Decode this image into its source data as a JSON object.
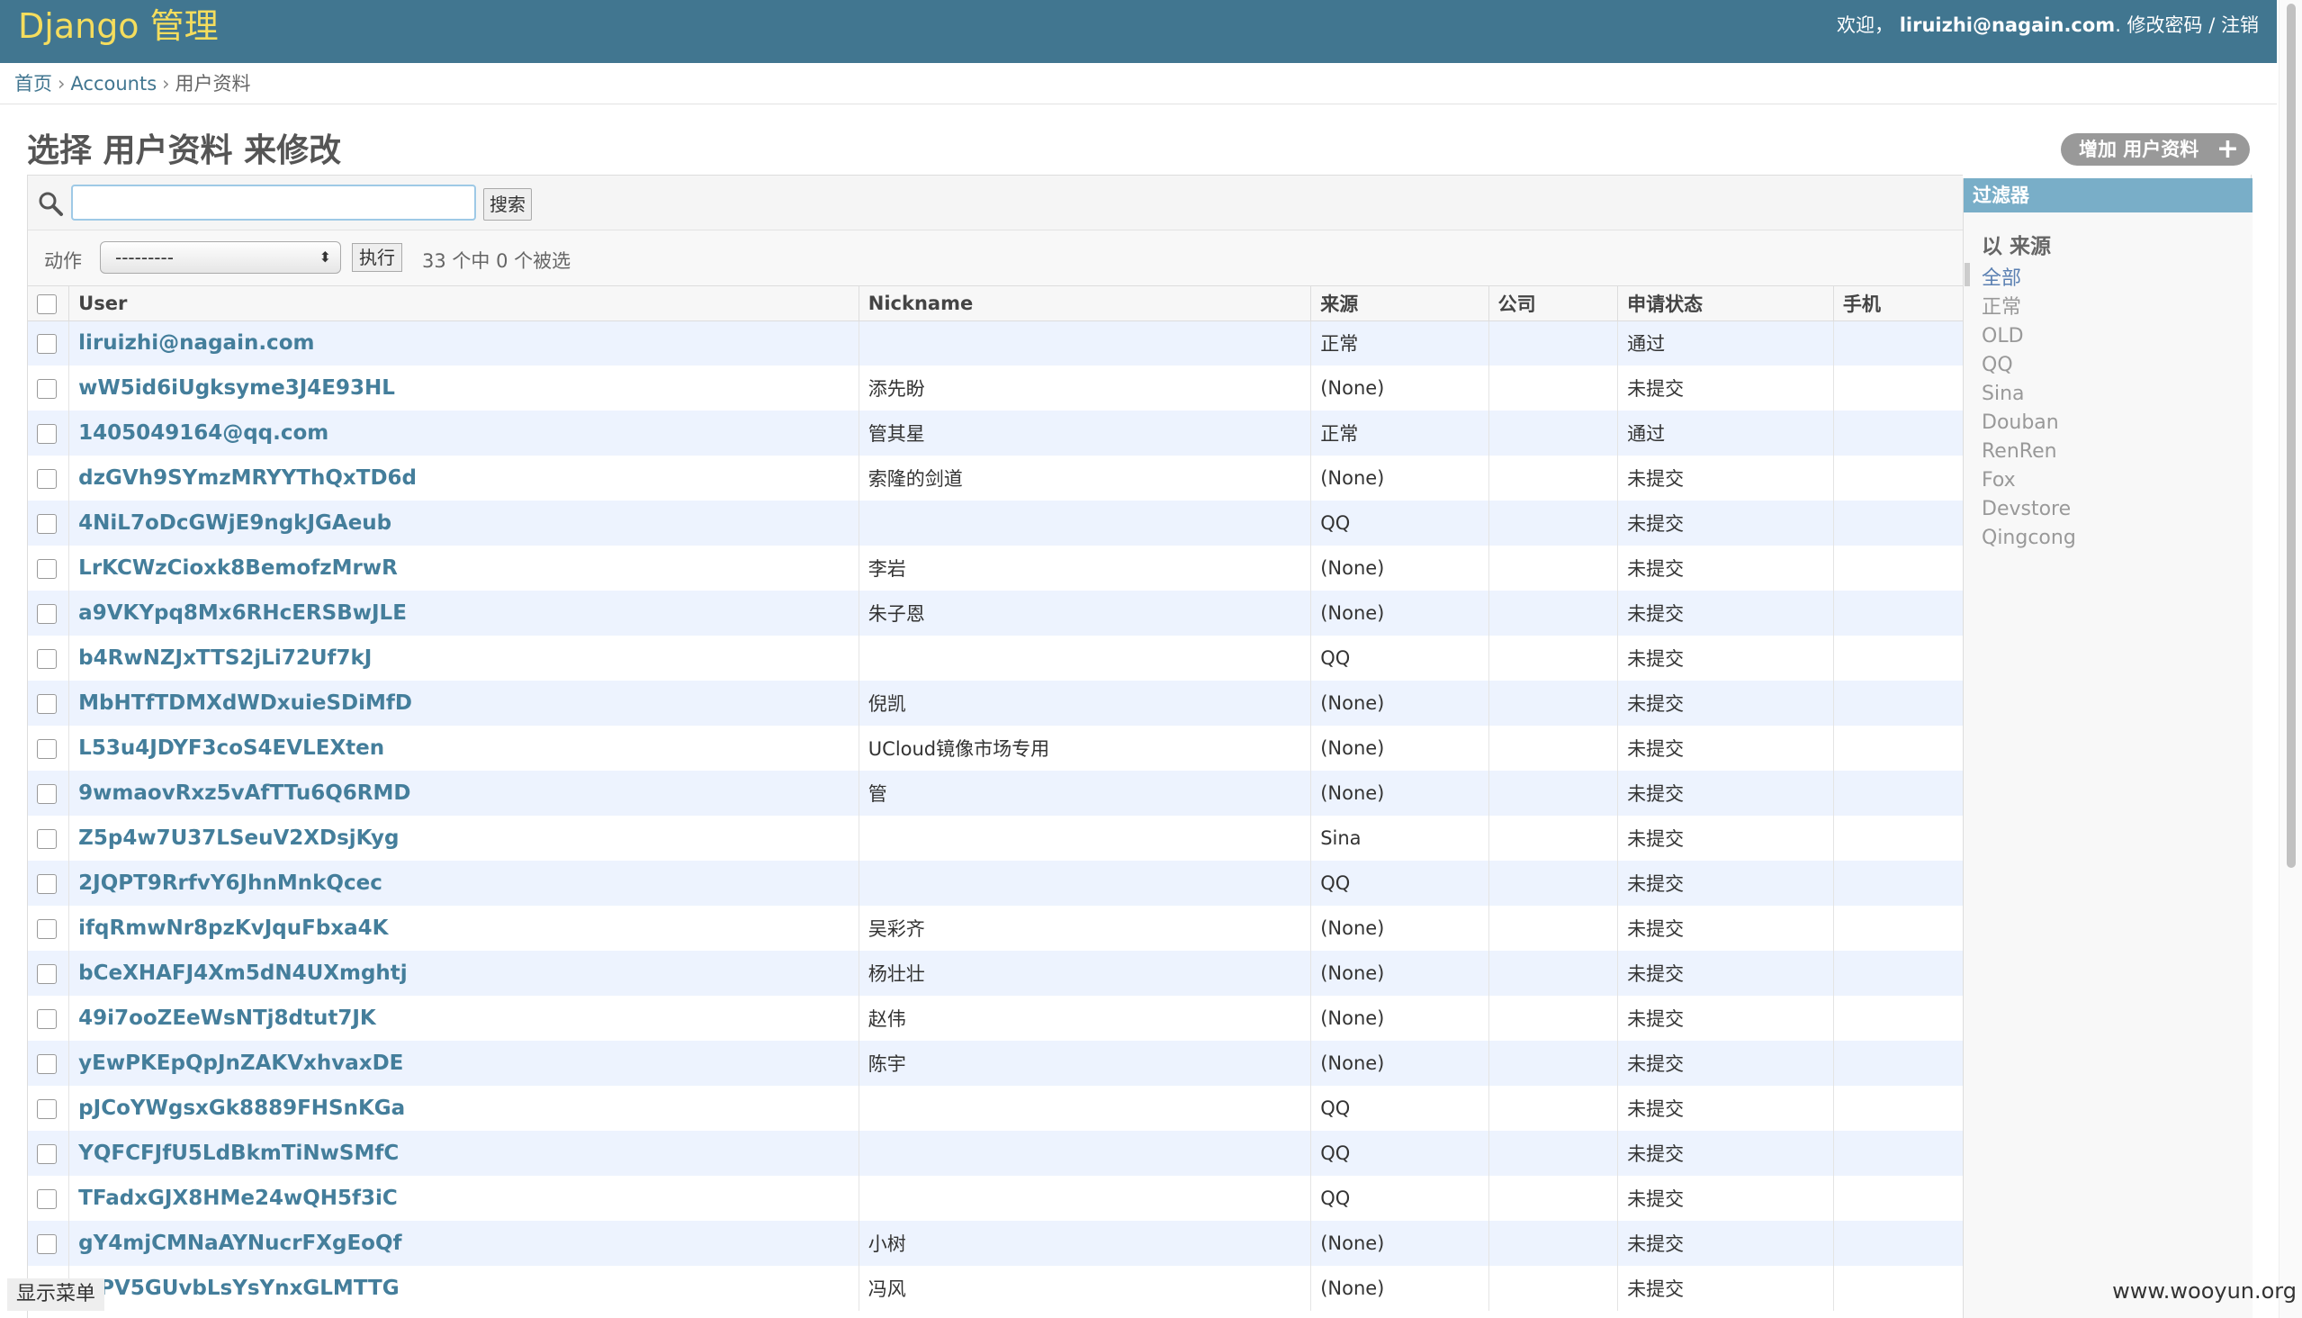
{
  "header": {
    "brand": "Django 管理",
    "welcome": "欢迎，",
    "user": "liruizhi@nagain.com",
    "change_password": "修改密码",
    "separator": "/",
    "logout": "注销"
  },
  "breadcrumbs": {
    "home": "首页",
    "app": "Accounts",
    "current": "用户资料",
    "sep": "›"
  },
  "page_title": "选择 用户资料 来修改",
  "add_button": {
    "label": "增加 用户资料",
    "plus": "+"
  },
  "search": {
    "value": "",
    "button": "搜索"
  },
  "actions": {
    "label": "动作",
    "selected": "---------",
    "go_button": "执行",
    "counter": "33 个中 0 个被选"
  },
  "table": {
    "columns": [
      "User",
      "Nickname",
      "来源",
      "公司",
      "申请状态",
      "手机"
    ],
    "rows": [
      {
        "user": "liruizhi@nagain.com",
        "nickname": "",
        "source": "正常",
        "company": "",
        "status": "通过",
        "phone": ""
      },
      {
        "user": "wW5id6iUgksyme3J4E93HL",
        "nickname": "添先盼",
        "source": "(None)",
        "company": "",
        "status": "未提交",
        "phone": ""
      },
      {
        "user": "1405049164@qq.com",
        "nickname": "管其星",
        "source": "正常",
        "company": "",
        "status": "通过",
        "phone": ""
      },
      {
        "user": "dzGVh9SYmzMRYYThQxTD6d",
        "nickname": "索隆的剑道",
        "source": "(None)",
        "company": "",
        "status": "未提交",
        "phone": ""
      },
      {
        "user": "4NiL7oDcGWjE9ngkJGAeub",
        "nickname": "",
        "source": "QQ",
        "company": "",
        "status": "未提交",
        "phone": ""
      },
      {
        "user": "LrKCWzCioxk8BemofzMrwR",
        "nickname": "李岩",
        "source": "(None)",
        "company": "",
        "status": "未提交",
        "phone": ""
      },
      {
        "user": "a9VKYpq8Mx6RHcERSBwJLE",
        "nickname": "朱子恩",
        "source": "(None)",
        "company": "",
        "status": "未提交",
        "phone": ""
      },
      {
        "user": "b4RwNZJxTTS2jLi72Uf7kJ",
        "nickname": "",
        "source": "QQ",
        "company": "",
        "status": "未提交",
        "phone": ""
      },
      {
        "user": "MbHTfTDMXdWDxuieSDiMfD",
        "nickname": "倪凯",
        "source": "(None)",
        "company": "",
        "status": "未提交",
        "phone": ""
      },
      {
        "user": "L53u4JDYF3coS4EVLEXten",
        "nickname": "UCloud镜像市场专用",
        "source": "(None)",
        "company": "",
        "status": "未提交",
        "phone": ""
      },
      {
        "user": "9wmaovRxz5vAfTTu6Q6RMD",
        "nickname": "管",
        "source": "(None)",
        "company": "",
        "status": "未提交",
        "phone": ""
      },
      {
        "user": "Z5p4w7U37LSeuV2XDsjKyg",
        "nickname": "",
        "source": "Sina",
        "company": "",
        "status": "未提交",
        "phone": ""
      },
      {
        "user": "2JQPT9RrfvY6JhnMnkQcec",
        "nickname": "",
        "source": "QQ",
        "company": "",
        "status": "未提交",
        "phone": ""
      },
      {
        "user": "ifqRmwNr8pzKvJquFbxa4K",
        "nickname": "吴彩齐",
        "source": "(None)",
        "company": "",
        "status": "未提交",
        "phone": ""
      },
      {
        "user": "bCeXHAFJ4Xm5dN4UXmghtj",
        "nickname": "杨壮壮",
        "source": "(None)",
        "company": "",
        "status": "未提交",
        "phone": ""
      },
      {
        "user": "49i7ooZEeWsNTj8dtut7JK",
        "nickname": "赵伟",
        "source": "(None)",
        "company": "",
        "status": "未提交",
        "phone": ""
      },
      {
        "user": "yEwPKEpQpJnZAKVxhvaxDE",
        "nickname": "陈宇",
        "source": "(None)",
        "company": "",
        "status": "未提交",
        "phone": ""
      },
      {
        "user": "pJCoYWgsxGk8889FHSnKGa",
        "nickname": "",
        "source": "QQ",
        "company": "",
        "status": "未提交",
        "phone": ""
      },
      {
        "user": "YQFCFJfU5LdBkmTiNwSMfC",
        "nickname": "",
        "source": "QQ",
        "company": "",
        "status": "未提交",
        "phone": ""
      },
      {
        "user": "TFadxGJX8HMe24wQH5f3iC",
        "nickname": "",
        "source": "QQ",
        "company": "",
        "status": "未提交",
        "phone": ""
      },
      {
        "user": "gY4mjCMNaAYNucrFXgEoQf",
        "nickname": "小树",
        "source": "(None)",
        "company": "",
        "status": "未提交",
        "phone": ""
      },
      {
        "user": "…PV5GUvbLsYsYnxGLMTTG",
        "nickname": "冯风",
        "source": "(None)",
        "company": "",
        "status": "未提交",
        "phone": ""
      }
    ]
  },
  "filter": {
    "header": "过滤器",
    "title": "以 来源",
    "items": [
      "全部",
      "正常",
      "OLD",
      "QQ",
      "Sina",
      "Douban",
      "RenRen",
      "Fox",
      "Devstore",
      "Qingcong"
    ],
    "selected_index": 0
  },
  "show_menu": "显示菜单",
  "watermark": "www.wooyun.org"
}
